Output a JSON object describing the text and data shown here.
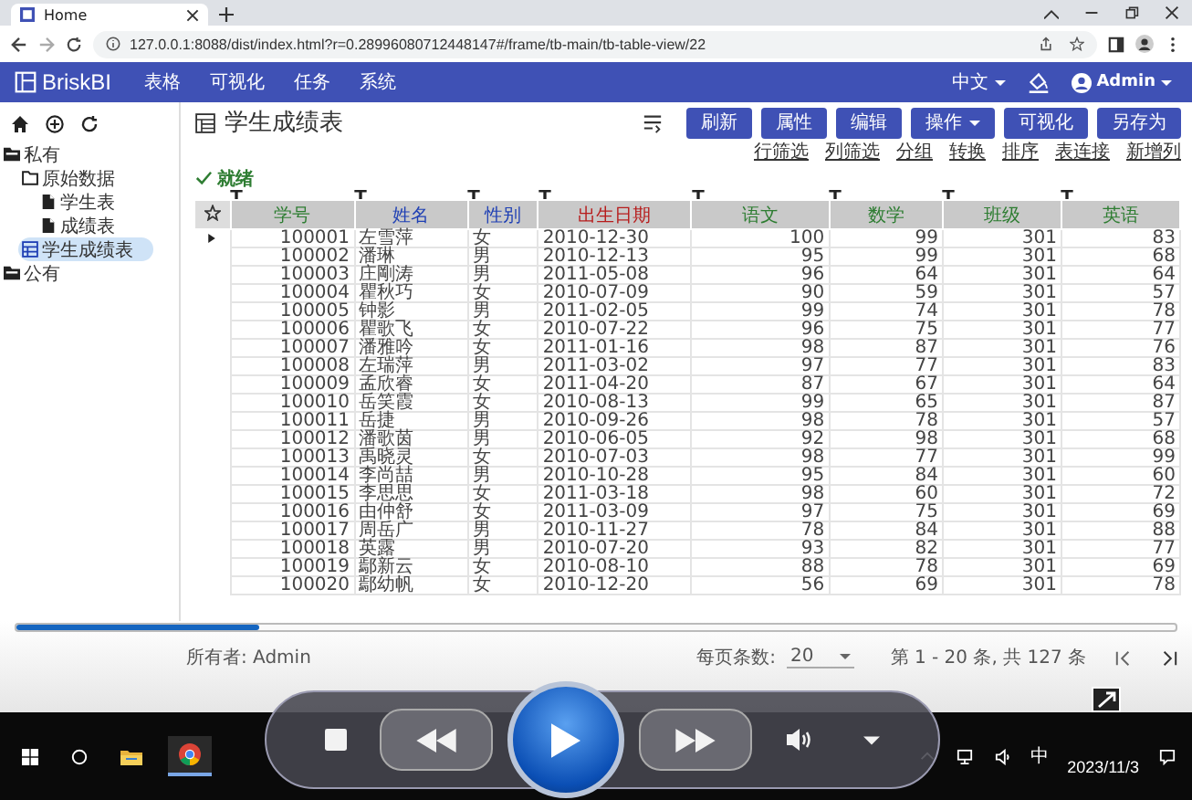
{
  "browser": {
    "tab_title": "Home",
    "url": "127.0.0.1:8088/dist/index.html?r=0.28996080712448147#/frame/tb-main/tb-table-view/22"
  },
  "header": {
    "logo": "BriskBI",
    "nav": [
      "表格",
      "可视化",
      "任务",
      "系统"
    ],
    "language": "中文",
    "user": "Admin"
  },
  "sidebar": {
    "tree": [
      {
        "label": "私有",
        "kind": "root",
        "selected": false,
        "children": [
          {
            "label": "原始数据",
            "kind": "folder",
            "selected": false,
            "children": [
              {
                "label": "学生表",
                "kind": "file",
                "selected": false
              },
              {
                "label": "成绩表",
                "kind": "file",
                "selected": false
              }
            ]
          },
          {
            "label": "学生成绩表",
            "kind": "table",
            "selected": true
          }
        ]
      },
      {
        "label": "公有",
        "kind": "root",
        "selected": false
      }
    ]
  },
  "page": {
    "title": "学生成绩表",
    "buttons": [
      {
        "label": "刷新",
        "kind": "button"
      },
      {
        "label": "属性",
        "kind": "button"
      },
      {
        "label": "编辑",
        "kind": "button"
      },
      {
        "label": "操作",
        "kind": "menu"
      },
      {
        "label": "可视化",
        "kind": "button"
      },
      {
        "label": "另存为",
        "kind": "button"
      }
    ],
    "links": [
      "行筛选",
      "列筛选",
      "分组",
      "转换",
      "排序",
      "表连接",
      "新增列"
    ],
    "status": "就绪"
  },
  "table": {
    "columns": [
      {
        "label": "学号",
        "color": "#2e7d32"
      },
      {
        "label": "姓名",
        "color": "#1e3fb4"
      },
      {
        "label": "性别",
        "color": "#1e3fb4"
      },
      {
        "label": "出生日期",
        "color": "#b71c1c"
      },
      {
        "label": "语文",
        "color": "#2e7d32"
      },
      {
        "label": "数学",
        "color": "#2e7d32"
      },
      {
        "label": "班级",
        "color": "#2e7d32"
      },
      {
        "label": "英语",
        "color": "#2e7d32"
      }
    ],
    "rows": [
      {
        "current": true,
        "cells": [
          "100001",
          "左雪萍",
          "女",
          "2010-12-30",
          "100",
          "99",
          "301",
          "83"
        ]
      },
      {
        "current": false,
        "cells": [
          "100002",
          "潘琳",
          "男",
          "2010-12-13",
          "95",
          "99",
          "301",
          "68"
        ]
      },
      {
        "current": false,
        "cells": [
          "100003",
          "庄剛涛",
          "男",
          "2011-05-08",
          "96",
          "64",
          "301",
          "64"
        ]
      },
      {
        "current": false,
        "cells": [
          "100004",
          "瞿秋巧",
          "女",
          "2010-07-09",
          "90",
          "59",
          "301",
          "57"
        ]
      },
      {
        "current": false,
        "cells": [
          "100005",
          "钟影",
          "男",
          "2011-02-05",
          "99",
          "74",
          "301",
          "78"
        ]
      },
      {
        "current": false,
        "cells": [
          "100006",
          "瞿歌飞",
          "女",
          "2010-07-22",
          "96",
          "75",
          "301",
          "77"
        ]
      },
      {
        "current": false,
        "cells": [
          "100007",
          "潘雅吟",
          "女",
          "2011-01-16",
          "98",
          "87",
          "301",
          "76"
        ]
      },
      {
        "current": false,
        "cells": [
          "100008",
          "左瑞萍",
          "男",
          "2011-03-02",
          "97",
          "77",
          "301",
          "83"
        ]
      },
      {
        "current": false,
        "cells": [
          "100009",
          "孟欣睿",
          "女",
          "2011-04-20",
          "87",
          "67",
          "301",
          "64"
        ]
      },
      {
        "current": false,
        "cells": [
          "100010",
          "岳笑霞",
          "女",
          "2010-08-13",
          "99",
          "65",
          "301",
          "87"
        ]
      },
      {
        "current": false,
        "cells": [
          "100011",
          "岳捷",
          "男",
          "2010-09-26",
          "98",
          "78",
          "301",
          "57"
        ]
      },
      {
        "current": false,
        "cells": [
          "100012",
          "潘歌茵",
          "男",
          "2010-06-05",
          "92",
          "98",
          "301",
          "68"
        ]
      },
      {
        "current": false,
        "cells": [
          "100013",
          "禹晓灵",
          "女",
          "2010-07-03",
          "98",
          "77",
          "301",
          "99"
        ]
      },
      {
        "current": false,
        "cells": [
          "100014",
          "李尚喆",
          "男",
          "2010-10-28",
          "95",
          "84",
          "301",
          "60"
        ]
      },
      {
        "current": false,
        "cells": [
          "100015",
          "李思思",
          "女",
          "2011-03-18",
          "98",
          "60",
          "301",
          "72"
        ]
      },
      {
        "current": false,
        "cells": [
          "100016",
          "由仲舒",
          "女",
          "2011-03-09",
          "97",
          "75",
          "301",
          "69"
        ]
      },
      {
        "current": false,
        "cells": [
          "100017",
          "周岳广",
          "男",
          "2010-11-27",
          "78",
          "84",
          "301",
          "88"
        ]
      },
      {
        "current": false,
        "cells": [
          "100018",
          "英露",
          "男",
          "2010-07-20",
          "93",
          "82",
          "301",
          "77"
        ]
      },
      {
        "current": false,
        "cells": [
          "100019",
          "鄢新云",
          "女",
          "2010-08-10",
          "88",
          "78",
          "301",
          "69"
        ]
      },
      {
        "current": false,
        "cells": [
          "100020",
          "鄢幼帆",
          "女",
          "2010-12-20",
          "56",
          "69",
          "301",
          "78"
        ]
      }
    ]
  },
  "footer": {
    "owner": "所有者: Admin",
    "page_size_label": "每页条数:",
    "page_size": "20",
    "range": "第 1 - 20 条, 共 127 条"
  },
  "player": {
    "seek_bar": {
      "level": 0.21
    }
  },
  "taskbar": {
    "ime": "中",
    "date": "2023/11/3"
  }
}
